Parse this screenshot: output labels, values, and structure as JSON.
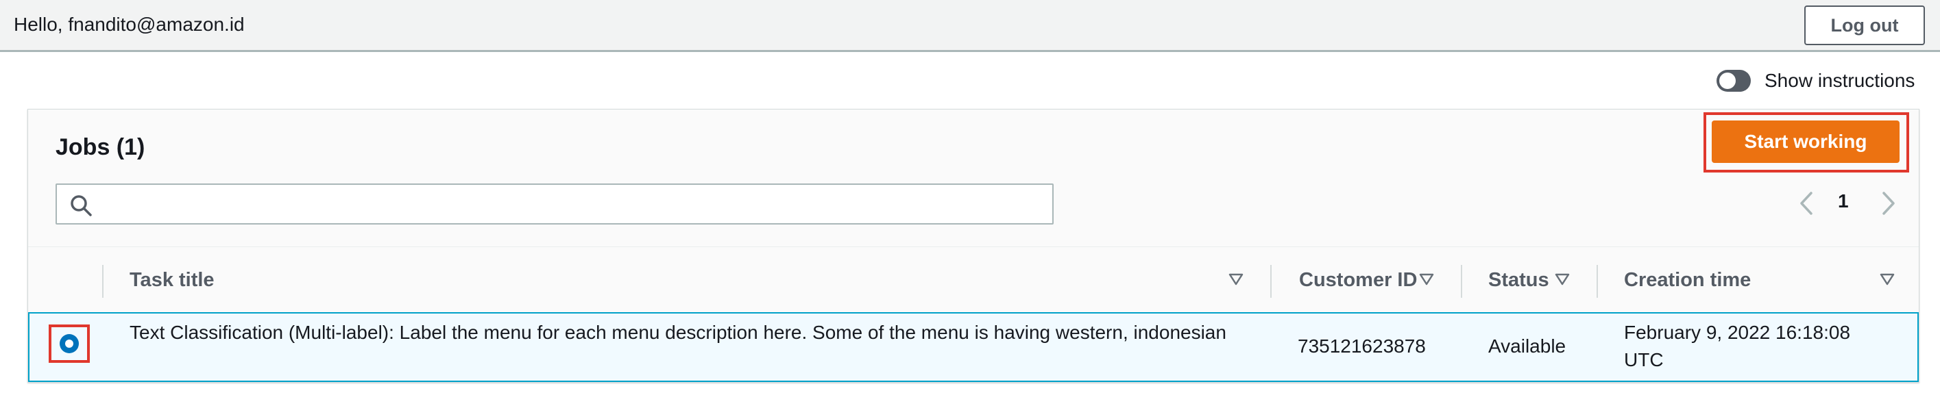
{
  "header": {
    "greeting": "Hello, fnandito@amazon.id",
    "logout_label": "Log out"
  },
  "instructions_toggle": {
    "label": "Show instructions",
    "on": false
  },
  "jobs": {
    "title": "Jobs (1)",
    "start_button_label": "Start working",
    "search": {
      "value": "",
      "placeholder": ""
    },
    "pagination": {
      "current_page": "1"
    },
    "columns": [
      "Task title",
      "Customer ID",
      "Status",
      "Creation time"
    ],
    "rows": [
      {
        "selected": true,
        "task_title": "Text Classification (Multi-label): Label the menu for each menu description here. Some of the menu is having western, indonesian",
        "customer_id": "735121623878",
        "status": "Available",
        "creation_time": "February 9, 2022 16:18:08 UTC"
      }
    ]
  },
  "colors": {
    "accent_orange": "#ec7211",
    "selection_blue": "#0073bb",
    "highlight_red": "#e0382d",
    "row_selected_bg": "#f1faff"
  },
  "icons": {
    "search": "search-icon",
    "prev": "chevron-left-icon",
    "next": "chevron-right-icon",
    "sort": "sort-down-icon"
  }
}
